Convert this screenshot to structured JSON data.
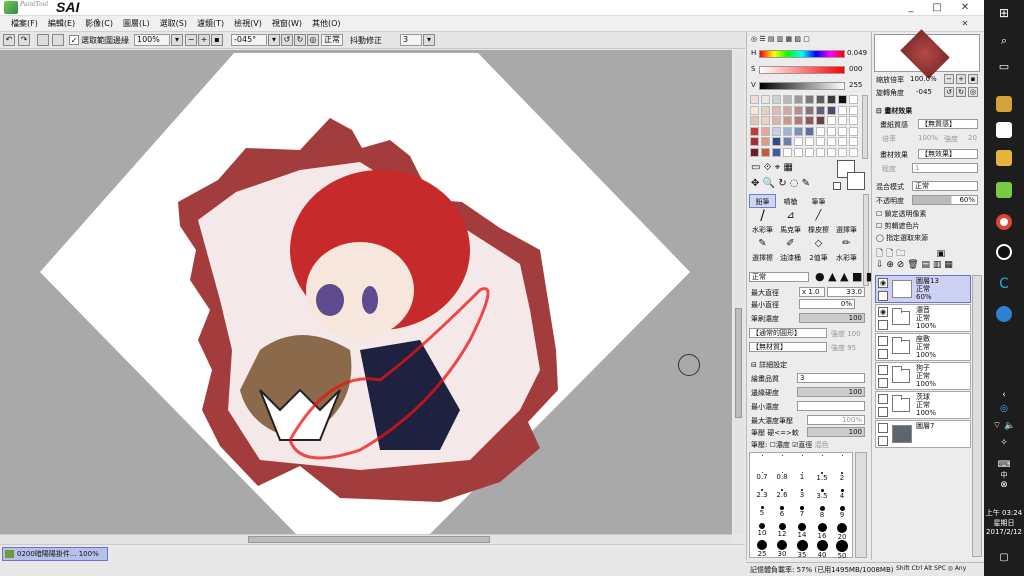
{
  "app": {
    "logo_small": "PaintTool",
    "logo_big": "SAI"
  },
  "window": {
    "minimize": "_",
    "maximize": "□",
    "close": "✕"
  },
  "menu": [
    "檔案(F)",
    "編輯(E)",
    "影像(C)",
    "圖層(L)",
    "選取(S)",
    "濾鏡(T)",
    "檢視(V)",
    "視窗(W)",
    "其他(O)"
  ],
  "toolbar": {
    "selection_checkbox_label": "選取範圍邊緣",
    "zoom": "100%",
    "angle": "-045°",
    "mode": "正常",
    "stabilizer_label": "抖動修正",
    "stabilizer": "3"
  },
  "document_tab": "0200暗陽陽掛件... 100%",
  "status": {
    "memory": "記憶體負載率: 57% (已用1495MB/1008MB)",
    "keys": "Shift Ctrl Alt SPC ◎ Any"
  },
  "color": {
    "h_value": "0",
    "h_ticks": "0.049",
    "s_label": "S",
    "s_value": "000",
    "v_label": "V",
    "v_value": "255",
    "slider_colors": {
      "h": "#ff0000",
      "fg": "#000000",
      "bg": "#ffffff"
    },
    "palette": [
      "#f3d9d9",
      "#e7e7e7",
      "#cfcfcf",
      "#b8b8b8",
      "#9a9a9a",
      "#7a7a7a",
      "#5d5d5d",
      "#3b3b3b",
      "#111111",
      "#ffffff",
      "#f7e9d8",
      "#e9cfc0",
      "#dfbcb0",
      "#cfa8a0",
      "#b58f92",
      "#8d7088",
      "#6c5a78",
      "#4b4a6d",
      "#ffffff",
      "#ffffff",
      "#e6c3b5",
      "#f0d2c4",
      "#d9b6a8",
      "#c99a88",
      "#b07f72",
      "#8b5c5a",
      "#6b4146",
      "#ffffff",
      "#ffffff",
      "#ffffff",
      "#c23a3a",
      "#e8a59a",
      "#c4d1e8",
      "#9fb3d4",
      "#7a8fb9",
      "#5b6fa0",
      "#ffffff",
      "#ffffff",
      "#ffffff",
      "#ffffff",
      "#a53030",
      "#d8a080",
      "#2f4a8a",
      "#6d7fb0",
      "#ffffff",
      "#ffffff",
      "#ffffff",
      "#ffffff",
      "#ffffff",
      "#ffffff",
      "#6d1f1f",
      "#c45a3a",
      "#3e5b9c",
      "#ffffff",
      "#ffffff",
      "#ffffff",
      "#ffffff",
      "#ffffff",
      "#ffffff",
      "#ffffff"
    ]
  },
  "tools": {
    "row1": [
      "鉛筆",
      "噴槍",
      "筆筆"
    ],
    "row2": [
      "水彩筆",
      "馬克筆",
      "橡皮擦",
      "選擇筆"
    ],
    "row3": [
      "選擇擦",
      "油漆桶",
      "2值筆",
      "水彩筆"
    ]
  },
  "brush": {
    "blend_mode": "正常",
    "max_size_label": "最大直徑",
    "max_size_mult": "x 1.0",
    "max_size_value": "33.0",
    "min_size_label": "最小直徑",
    "min_size_value": "0%",
    "density_label": "筆刷濃度",
    "density_value": "100",
    "shape_label": "【通常的圓形】",
    "shape_strength": "強度 100",
    "texture_label": "【無材質】",
    "texture_strength": "強度 95",
    "detail_label": "詳細設定",
    "quality_label": "繪畫品質",
    "quality_value": "3",
    "edge_label": "邊緣硬度",
    "edge_value": "100",
    "min_density_label": "最小濃度",
    "min_density_value": "",
    "max_pressure_label": "最大濃度筆壓",
    "max_pressure_value": "100%",
    "hardness_label": "筆壓 硬<=>軟",
    "hardness_value": "100",
    "pressure_label": "筆壓:",
    "pressure_opts": [
      "濃度",
      "直徑",
      "混色"
    ],
    "sizes_row1": [
      "",
      "",
      "",
      "",
      ""
    ],
    "sizes_row2": [
      "0.7",
      "0.8",
      "1",
      "1.5",
      "2"
    ],
    "sizes_row3": [
      "2.3",
      "2.6",
      "3",
      "3.5",
      "4"
    ],
    "sizes_row4": [
      "5",
      "6",
      "7",
      "8",
      "9"
    ],
    "sizes_row5": [
      "10",
      "12",
      "14",
      "16",
      "20"
    ],
    "sizes_row6": [
      "25",
      "30",
      "35",
      "40",
      "50"
    ]
  },
  "layers_panel": {
    "zoom_label": "縮放倍率",
    "zoom_value": "100.0%",
    "angle_label": "旋轉角度",
    "angle_value": "-045",
    "paper_section": "畫材效果",
    "paper_texture_label": "畫紙質感",
    "paper_texture_value": "【無質感】",
    "paper_texture_sub1": "倍率",
    "paper_texture_sub1_val": "100%",
    "paper_texture_sub2": "強度",
    "paper_texture_sub2_val": "20",
    "paper_effect_label": "畫材效果",
    "paper_effect_value": "【無效果】",
    "paper_effect_sub": "程度",
    "paper_effect_sub_val": "1",
    "blend_label": "混合模式",
    "blend_value": "正常",
    "opacity_label": "不透明度",
    "opacity_value": "60%",
    "check1": "鎖定透明像素",
    "check2": "剪輯遮色片",
    "check3": "指定選取來源",
    "layers": [
      {
        "name": "圖層13",
        "mode": "正常",
        "opacity": "60%",
        "type": "layer",
        "selected": true
      },
      {
        "name": "濃音",
        "mode": "正常",
        "opacity": "100%",
        "type": "folder"
      },
      {
        "name": "座敷",
        "mode": "正常",
        "opacity": "100%",
        "type": "folder"
      },
      {
        "name": "狗子",
        "mode": "正常",
        "opacity": "100%",
        "type": "folder"
      },
      {
        "name": "茨球",
        "mode": "正常",
        "opacity": "100%",
        "type": "folder"
      },
      {
        "name": "圖層7",
        "mode": "",
        "opacity": "",
        "type": "layer"
      }
    ]
  },
  "taskbar": {
    "time": "上午 03:24",
    "weekday": "星期日",
    "date": "2017/2/12",
    "lang": "中"
  }
}
